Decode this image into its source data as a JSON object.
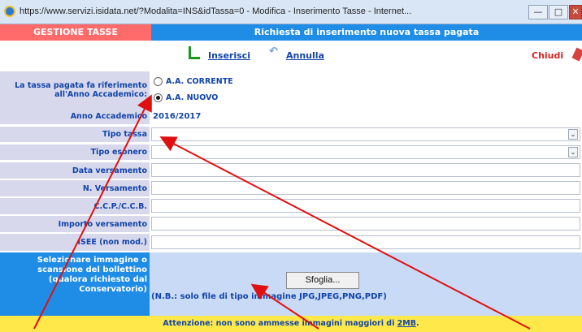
{
  "window": {
    "title": "https://www.servizi.isidata.net/?Modalita=INS&idTassa=0 - Modifica - Inserimento Tasse - Internet...",
    "minimize_glyph": "—",
    "maximize_glyph": "□",
    "close_glyph": "✕"
  },
  "header": {
    "section": "GESTIONE TASSE",
    "title": "Richiesta di inserimento nuova tassa pagata"
  },
  "toolbar": {
    "insert_label": "Inserisci",
    "cancel_label": "Annulla",
    "close_label": "Chiudi"
  },
  "form": {
    "year_ref_label": "La tassa pagata fa riferimento all'Anno Accademico:",
    "year_options": [
      {
        "label": "A.A. CORRENTE",
        "checked": false
      },
      {
        "label": "A.A. NUOVO",
        "checked": true
      }
    ],
    "anno_label": "Anno Accademico",
    "anno_value": "2016/2017",
    "tipo_tassa_label": "Tipo tassa",
    "tipo_esonero_label": "Tipo esonero",
    "data_versamento_label": "Data versamento",
    "n_versamento_label": "N. Versamento",
    "ccp_label": "C.C.P./C.C.B.",
    "importo_label": "Importo versamento",
    "isee_label": "ISEE (non mod.)",
    "select_arrow": "⌄"
  },
  "upload": {
    "label": "Selezionare immagine o scansione del bollettino (qualora richiesto dal Conservatorio)",
    "button_label": "Sfoglia...",
    "note": "(N.B.: solo file di tipo immagine JPG,JPEG,PNG,PDF)"
  },
  "warning": {
    "text": "Attenzione: non sono ammesse immagini maggiori di ",
    "size": "2MB",
    "suffix": "."
  },
  "colors": {
    "header_left": "#ff6b6b",
    "header_right": "#1f8ce6",
    "label_bg": "#d8d8ec",
    "warning_bg": "#ffe84a",
    "annotation_arrow": "#e01010"
  }
}
